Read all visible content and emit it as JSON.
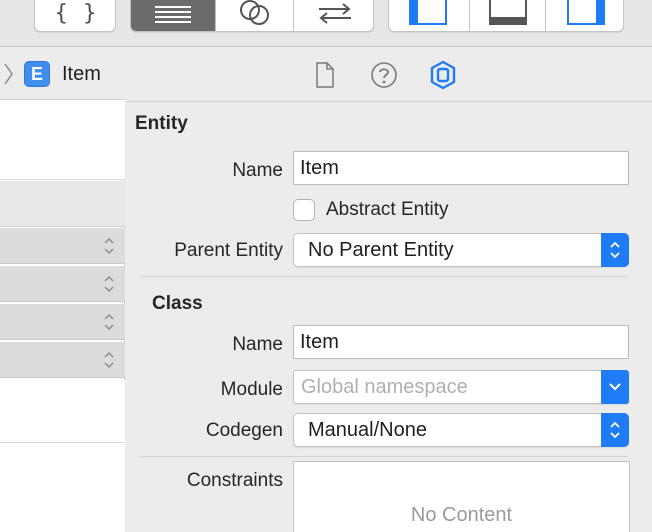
{
  "toolbar": {
    "code_view_icon": "curly-braces-icon",
    "braces_text": "{ }",
    "table_view_icon": "list-lines-icon",
    "venn_icon": "overlapping-circles-icon",
    "swap_icon": "arrows-left-right-icon",
    "left_panel_icon": "left-sidebar-icon",
    "bottom_panel_icon": "bottom-panel-icon",
    "right_panel_icon": "right-sidebar-icon",
    "accent": "#1f7cf5"
  },
  "navigator": {
    "entity_badge": "E",
    "entity_name": "Item"
  },
  "inspector": {
    "tabs": [
      {
        "icon": "document-icon"
      },
      {
        "icon": "help-icon"
      },
      {
        "icon": "data-model-inspector-icon",
        "active": true
      }
    ],
    "entity": {
      "title": "Entity",
      "name_label": "Name",
      "name_value": "Item",
      "abstract_label": "Abstract Entity",
      "abstract_checked": false,
      "parent_label": "Parent Entity",
      "parent_value": "No Parent Entity"
    },
    "class": {
      "title": "Class",
      "name_label": "Name",
      "name_value": "Item",
      "module_label": "Module",
      "module_placeholder": "Global namespace",
      "codegen_label": "Codegen",
      "codegen_value": "Manual/None"
    },
    "constraints": {
      "label": "Constraints",
      "empty_text": "No Content"
    }
  }
}
